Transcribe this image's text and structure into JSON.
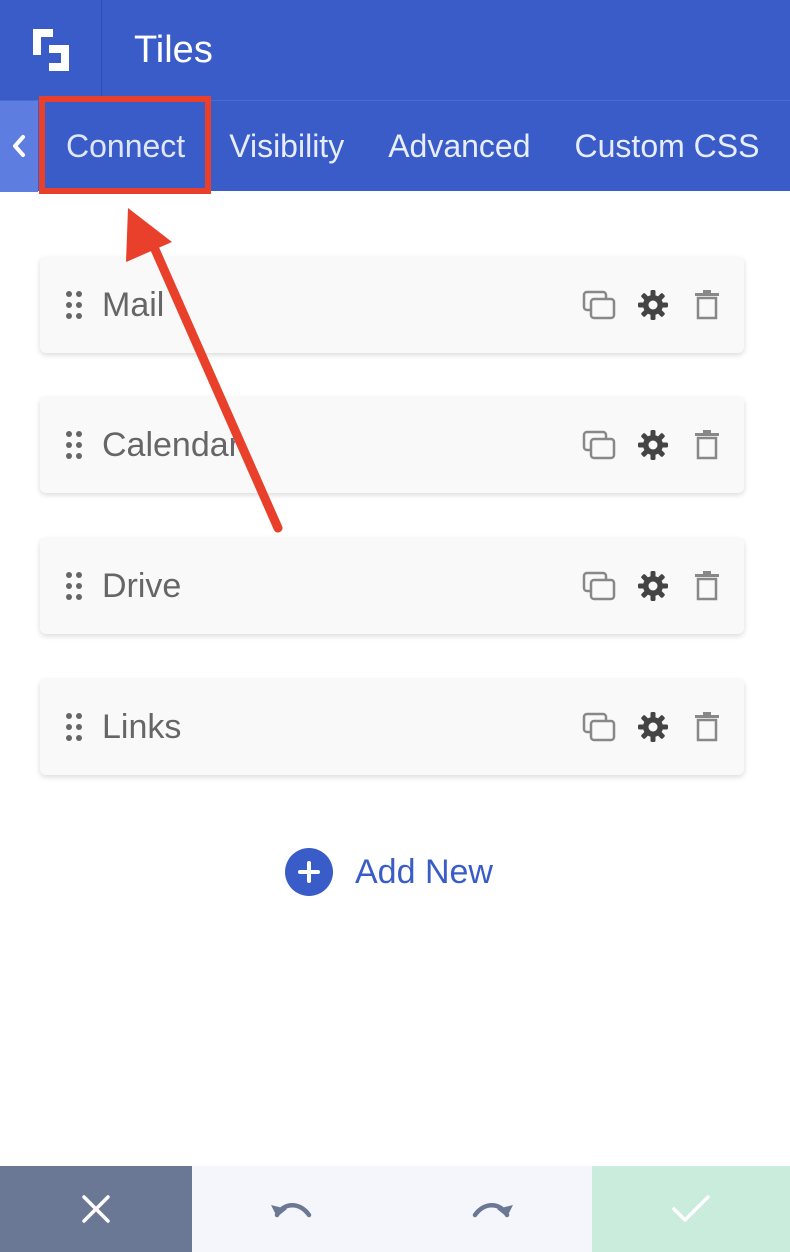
{
  "header": {
    "title": "Tiles"
  },
  "tabs": [
    {
      "label": "Connect"
    },
    {
      "label": "Visibility"
    },
    {
      "label": "Advanced"
    },
    {
      "label": "Custom CSS"
    }
  ],
  "tiles": [
    {
      "label": "Mail"
    },
    {
      "label": "Calendar"
    },
    {
      "label": "Drive"
    },
    {
      "label": "Links"
    }
  ],
  "add_new": {
    "label": "Add New"
  },
  "icons": {
    "logo": "logo-icon",
    "back": "chevron-left-icon",
    "drag": "drag-handle-icon",
    "duplicate": "duplicate-icon",
    "settings": "gear-icon",
    "delete": "trash-icon",
    "add": "plus-icon",
    "cancel": "close-icon",
    "undo": "undo-icon",
    "redo": "redo-icon",
    "save": "check-icon"
  },
  "colors": {
    "brand": "#3a5cc8",
    "annotation": "#e8402a",
    "cancel_bg": "#6b7895",
    "save_bg": "#c9ecdc"
  }
}
